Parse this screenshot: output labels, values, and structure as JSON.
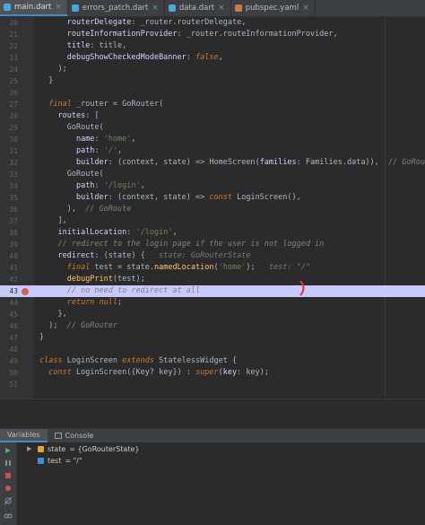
{
  "tabs": [
    {
      "label": "main.dart",
      "active": true
    },
    {
      "label": "errors_patch.dart",
      "active": false
    },
    {
      "label": "data.dart",
      "active": false
    },
    {
      "label": "pubspec.yaml",
      "active": false
    }
  ],
  "lines": [
    {
      "num": "20",
      "html": "      routerDelegate: _router.routerDelegate,"
    },
    {
      "num": "21",
      "html": "      routeInformationProvider: _router.routeInformationProvider,"
    },
    {
      "num": "22",
      "html": "      title: title,"
    },
    {
      "num": "23",
      "html": "      debugShowCheckedModeBanner: false,"
    },
    {
      "num": "24",
      "html": "    );"
    },
    {
      "num": "25",
      "html": "  }"
    },
    {
      "num": "26",
      "html": ""
    },
    {
      "num": "27",
      "html": "  final _router = GoRouter("
    },
    {
      "num": "28",
      "html": "    routes: ["
    },
    {
      "num": "29",
      "html": "      GoRoute("
    },
    {
      "num": "30",
      "html": "        name: 'home',"
    },
    {
      "num": "31",
      "html": "        path: '/',"
    },
    {
      "num": "32",
      "html": "        builder: (context, state) => HomeScreen(families: Families.data)),  // GoRoute"
    },
    {
      "num": "33",
      "html": "      GoRoute("
    },
    {
      "num": "34",
      "html": "        path: '/login',"
    },
    {
      "num": "35",
      "html": "        builder: (context, state) => const LoginScreen(),"
    },
    {
      "num": "36",
      "html": "      ),  // GoRoute"
    },
    {
      "num": "37",
      "html": "    ],"
    },
    {
      "num": "38",
      "html": "    initialLocation: '/login',"
    },
    {
      "num": "39",
      "html": "    // redirect to the login page if the user is not logged in"
    },
    {
      "num": "40",
      "html": "    redirect: (state) {   state: GoRouterState"
    },
    {
      "num": "41",
      "html": "      final test = state.namedLocation('home');   test: \"/\""
    },
    {
      "num": "42",
      "html": "      debugPrint(test);"
    },
    {
      "num": "43",
      "html": "      // no need to redirect at all"
    },
    {
      "num": "44",
      "html": "      return null;"
    },
    {
      "num": "45",
      "html": "    },"
    },
    {
      "num": "46",
      "html": "  );  // GoRouter"
    },
    {
      "num": "47",
      "html": "}"
    },
    {
      "num": "48",
      "html": ""
    },
    {
      "num": "49",
      "html": "class LoginScreen extends StatelessWidget {"
    },
    {
      "num": "50",
      "html": "  const LoginScreen({Key? key}) : super(key: key);"
    },
    {
      "num": "51",
      "html": ""
    }
  ],
  "highlight_line": "43",
  "breakpoint_line": "43",
  "debug": {
    "tabs": [
      {
        "label": "Variables",
        "active": true
      },
      {
        "label": "Console",
        "active": false
      }
    ],
    "variables": [
      {
        "name": "state",
        "value": "= {GoRouterState}",
        "expandable": true,
        "icon": "object-icon"
      },
      {
        "name": "test",
        "value": "= \"/\"",
        "expandable": false,
        "icon": "string-icon"
      }
    ]
  },
  "colors": {
    "background": "#2b2b2b",
    "highlight": "#c9cafc",
    "keyword": "#cc7832",
    "string": "#6a8759",
    "comment": "#808080",
    "breakpoint": "#db5c5c"
  }
}
